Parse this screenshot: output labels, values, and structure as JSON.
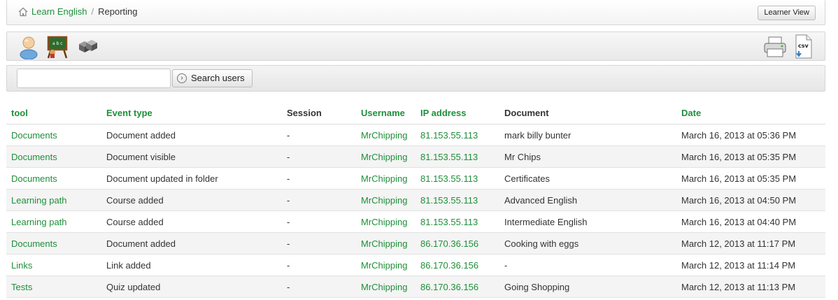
{
  "breadcrumb": {
    "home": "Learn English",
    "separator": "/",
    "current": "Reporting"
  },
  "toolbar": {
    "learner_view_label": "Learner View"
  },
  "icons": {
    "left": [
      "user-icon",
      "course-blackboard-icon",
      "group-icon"
    ],
    "right": [
      "print-icon",
      "csv-export-icon"
    ],
    "csv_label": "csv"
  },
  "search": {
    "value": "",
    "placeholder": "",
    "button_label": "Search users"
  },
  "table": {
    "headers": {
      "tool": "tool",
      "event_type": "Event type",
      "session": "Session",
      "username": "Username",
      "ip": "IP address",
      "document": "Document",
      "date": "Date"
    },
    "rows": [
      {
        "tool": "Documents",
        "event": "Document added",
        "session": "-",
        "username": "MrChipping",
        "ip": "81.153.55.113",
        "document": "mark billy bunter",
        "date": "March 16, 2013 at 05:36 PM"
      },
      {
        "tool": "Documents",
        "event": "Document visible",
        "session": "-",
        "username": "MrChipping",
        "ip": "81.153.55.113",
        "document": "Mr Chips",
        "date": "March 16, 2013 at 05:35 PM"
      },
      {
        "tool": "Documents",
        "event": "Document updated in folder",
        "session": "-",
        "username": "MrChipping",
        "ip": "81.153.55.113",
        "document": "Certificates",
        "date": "March 16, 2013 at 05:35 PM"
      },
      {
        "tool": "Learning path",
        "event": "Course added",
        "session": "-",
        "username": "MrChipping",
        "ip": "81.153.55.113",
        "document": "Advanced English",
        "date": "March 16, 2013 at 04:50 PM"
      },
      {
        "tool": "Learning path",
        "event": "Course added",
        "session": "-",
        "username": "MrChipping",
        "ip": "81.153.55.113",
        "document": "Intermediate English",
        "date": "March 16, 2013 at 04:40 PM"
      },
      {
        "tool": "Documents",
        "event": "Document added",
        "session": "-",
        "username": "MrChipping",
        "ip": "86.170.36.156",
        "document": "Cooking with eggs",
        "date": "March 12, 2013 at 11:17 PM"
      },
      {
        "tool": "Links",
        "event": "Link added",
        "session": "-",
        "username": "MrChipping",
        "ip": "86.170.36.156",
        "document": "-",
        "date": "March 12, 2013 at 11:14 PM"
      },
      {
        "tool": "Tests",
        "event": "Quiz updated",
        "session": "-",
        "username": "MrChipping",
        "ip": "86.170.36.156",
        "document": "Going Shopping",
        "date": "March 12, 2013 at 11:13 PM"
      }
    ]
  },
  "colors": {
    "link_green": "#1f8f3a",
    "row_alt": "#f4f4f4"
  }
}
